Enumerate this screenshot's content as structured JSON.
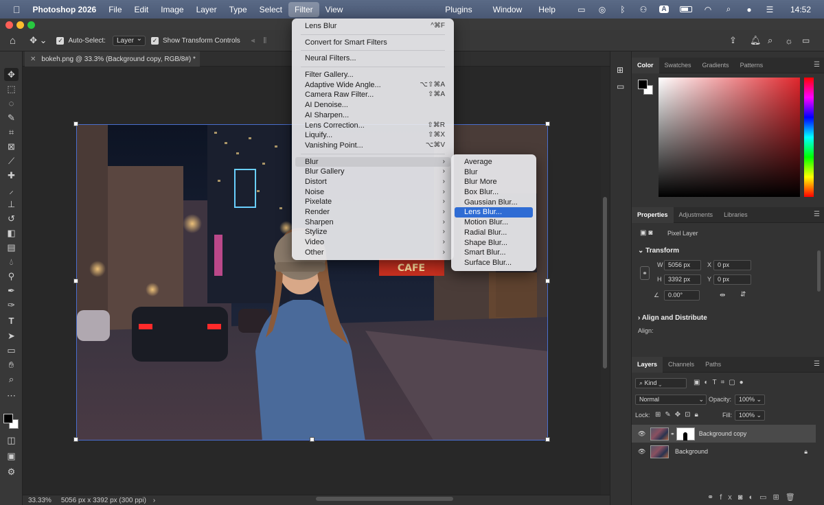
{
  "menubar": {
    "app_name": "Photoshop 2026",
    "items": [
      "File",
      "Edit",
      "Image",
      "Layer",
      "Type",
      "Select",
      "Filter",
      "View"
    ],
    "right_items": [
      "Plugins",
      "Window",
      "Help"
    ],
    "clock": "14:52",
    "status_letter": "A"
  },
  "options_bar": {
    "auto_select_label": "Auto-Select:",
    "auto_select_value": "Layer",
    "show_transform_label": "Show Transform Controls"
  },
  "document": {
    "tab_title": "bokeh.png @ 33.3% (Background copy, RGB/8#) *",
    "zoom": "33.33%",
    "doc_info": "5056 px x 3392 px (300 ppi)",
    "photo_sign": "CAFE"
  },
  "filter_menu": {
    "items": [
      {
        "label": "Lens Blur",
        "shortcut": "^⌘F"
      },
      {
        "sep": true
      },
      {
        "label": "Convert for Smart Filters"
      },
      {
        "sep": true
      },
      {
        "label": "Neural Filters..."
      },
      {
        "sep": true
      },
      {
        "label": "Filter Gallery..."
      },
      {
        "label": "Adaptive Wide Angle...",
        "shortcut": "⌥⇧⌘A"
      },
      {
        "label": "Camera Raw Filter...",
        "shortcut": "⇧⌘A"
      },
      {
        "label": "AI Denoise..."
      },
      {
        "label": "AI Sharpen..."
      },
      {
        "label": "Lens Correction...",
        "shortcut": "⇧⌘R"
      },
      {
        "label": "Liquify...",
        "shortcut": "⇧⌘X"
      },
      {
        "label": "Vanishing Point...",
        "shortcut": "⌥⌘V"
      },
      {
        "sep": true
      },
      {
        "label": "Blur",
        "submenu": true,
        "hover": true
      },
      {
        "label": "Blur Gallery",
        "submenu": true
      },
      {
        "label": "Distort",
        "submenu": true
      },
      {
        "label": "Noise",
        "submenu": true
      },
      {
        "label": "Pixelate",
        "submenu": true
      },
      {
        "label": "Render",
        "submenu": true
      },
      {
        "label": "Sharpen",
        "submenu": true
      },
      {
        "label": "Stylize",
        "submenu": true
      },
      {
        "label": "Video",
        "submenu": true
      },
      {
        "label": "Other",
        "submenu": true
      }
    ]
  },
  "blur_submenu": {
    "items": [
      "Average",
      "Blur",
      "Blur More",
      "Box Blur...",
      "Gaussian Blur...",
      "Lens Blur...",
      "Motion Blur...",
      "Radial Blur...",
      "Shape Blur...",
      "Smart Blur...",
      "Surface Blur..."
    ],
    "selected_index": 5
  },
  "color_panel": {
    "tabs": [
      "Color",
      "Swatches",
      "Gradients",
      "Patterns"
    ],
    "active": 0,
    "hue_color": "#e0262c"
  },
  "properties_panel": {
    "tabs": [
      "Properties",
      "Adjustments",
      "Libraries"
    ],
    "layer_type": "Pixel Layer",
    "transform_header": "Transform",
    "w_label": "W",
    "w_value": "5056 px",
    "h_label": "H",
    "h_value": "3392 px",
    "x_label": "X",
    "x_value": "0 px",
    "y_label": "Y",
    "y_value": "0 px",
    "angle_value": "0.00°",
    "align_header": "Align and Distribute",
    "align_label": "Align:"
  },
  "layers_panel": {
    "tabs": [
      "Layers",
      "Channels",
      "Paths"
    ],
    "filter_kind": "Kind",
    "blend_mode": "Normal",
    "opacity_label": "Opacity:",
    "opacity_value": "100%",
    "lock_label": "Lock:",
    "fill_label": "Fill:",
    "fill_value": "100%",
    "layers": [
      {
        "name": "Background copy",
        "selected": true
      },
      {
        "name": "Background",
        "locked": true
      }
    ]
  }
}
